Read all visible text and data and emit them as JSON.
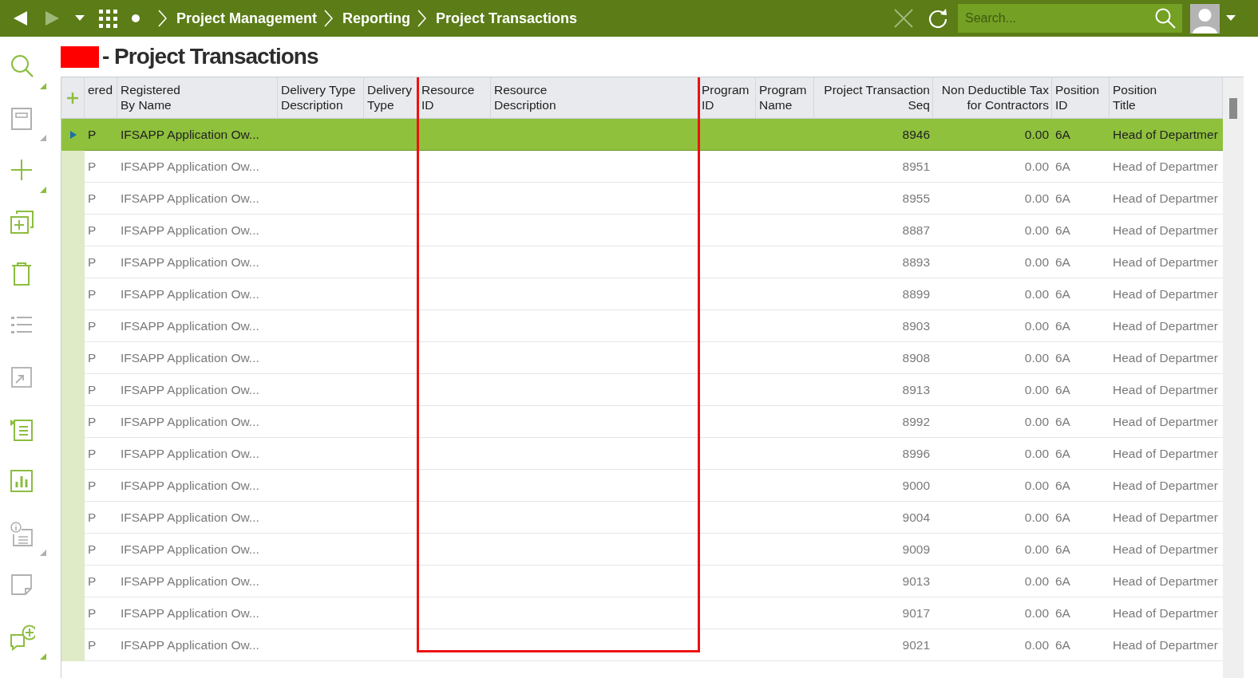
{
  "nav": {
    "breadcrumbs": [
      "Project Management",
      "Reporting",
      "Project Transactions"
    ],
    "search": {
      "placeholder": "Search..."
    }
  },
  "sidebar": {
    "tools": [
      {
        "kind": "search",
        "disabled": false,
        "has_menu": true
      },
      {
        "kind": "save",
        "disabled": true,
        "has_menu": true
      },
      {
        "kind": "add",
        "disabled": false,
        "has_menu": true
      },
      {
        "kind": "duplicate",
        "disabled": false,
        "has_menu": false
      },
      {
        "kind": "delete",
        "disabled": false,
        "has_menu": false
      },
      {
        "kind": "list",
        "disabled": true,
        "has_menu": false
      },
      {
        "kind": "export",
        "disabled": true,
        "has_menu": false
      },
      {
        "kind": "details",
        "disabled": false,
        "has_menu": false
      },
      {
        "kind": "chart",
        "disabled": false,
        "has_menu": false
      },
      {
        "kind": "info",
        "disabled": true,
        "has_menu": true
      },
      {
        "kind": "note",
        "disabled": true,
        "has_menu": false
      },
      {
        "kind": "comment",
        "disabled": false,
        "has_menu": true
      }
    ]
  },
  "page": {
    "redacted": true,
    "title": "- Project Transactions"
  },
  "table": {
    "columns": [
      {
        "label": "ered",
        "highlighted": false
      },
      {
        "label": "Registered By Name",
        "highlighted": false
      },
      {
        "label": "Delivery Type Description",
        "highlighted": false
      },
      {
        "label": "Delivery Type",
        "highlighted": false
      },
      {
        "label": "Resource ID",
        "highlighted": true
      },
      {
        "label": "Resource Description",
        "highlighted": true
      },
      {
        "label": "Program ID",
        "highlighted": false
      },
      {
        "label": "Program Name",
        "highlighted": false
      },
      {
        "label": "Project Transaction Seq",
        "highlighted": false
      },
      {
        "label": "Non Deductible Tax for Contractors",
        "highlighted": false
      },
      {
        "label": "Position ID",
        "highlighted": false
      },
      {
        "label": "Position Title",
        "highlighted": false
      }
    ],
    "rows": [
      {
        "selected": true,
        "cells": [
          "P",
          "IFSAPP Application Ow...",
          null,
          null,
          null,
          null,
          null,
          null,
          "8946",
          "0.00",
          "6A",
          "Head of Departmer"
        ]
      },
      {
        "selected": false,
        "cells": [
          "P",
          "IFSAPP Application Ow...",
          null,
          null,
          null,
          null,
          null,
          null,
          "8951",
          "0.00",
          "6A",
          "Head of Departmer"
        ]
      },
      {
        "selected": false,
        "cells": [
          "P",
          "IFSAPP Application Ow...",
          null,
          null,
          null,
          null,
          null,
          null,
          "8955",
          "0.00",
          "6A",
          "Head of Departmer"
        ]
      },
      {
        "selected": false,
        "cells": [
          "P",
          "IFSAPP Application Ow...",
          null,
          null,
          null,
          null,
          null,
          null,
          "8887",
          "0.00",
          "6A",
          "Head of Departmer"
        ]
      },
      {
        "selected": false,
        "cells": [
          "P",
          "IFSAPP Application Ow...",
          null,
          null,
          null,
          null,
          null,
          null,
          "8893",
          "0.00",
          "6A",
          "Head of Departmer"
        ]
      },
      {
        "selected": false,
        "cells": [
          "P",
          "IFSAPP Application Ow...",
          null,
          null,
          null,
          null,
          null,
          null,
          "8899",
          "0.00",
          "6A",
          "Head of Departmer"
        ]
      },
      {
        "selected": false,
        "cells": [
          "P",
          "IFSAPP Application Ow...",
          null,
          null,
          null,
          null,
          null,
          null,
          "8903",
          "0.00",
          "6A",
          "Head of Departmer"
        ]
      },
      {
        "selected": false,
        "cells": [
          "P",
          "IFSAPP Application Ow...",
          null,
          null,
          null,
          null,
          null,
          null,
          "8908",
          "0.00",
          "6A",
          "Head of Departmer"
        ]
      },
      {
        "selected": false,
        "cells": [
          "P",
          "IFSAPP Application Ow...",
          null,
          null,
          null,
          null,
          null,
          null,
          "8913",
          "0.00",
          "6A",
          "Head of Departmer"
        ]
      },
      {
        "selected": false,
        "cells": [
          "P",
          "IFSAPP Application Ow...",
          null,
          null,
          null,
          null,
          null,
          null,
          "8992",
          "0.00",
          "6A",
          "Head of Departmer"
        ]
      },
      {
        "selected": false,
        "cells": [
          "P",
          "IFSAPP Application Ow...",
          null,
          null,
          null,
          null,
          null,
          null,
          "8996",
          "0.00",
          "6A",
          "Head of Departmer"
        ]
      },
      {
        "selected": false,
        "cells": [
          "P",
          "IFSAPP Application Ow...",
          null,
          null,
          null,
          null,
          null,
          null,
          "9000",
          "0.00",
          "6A",
          "Head of Departmer"
        ]
      },
      {
        "selected": false,
        "cells": [
          "P",
          "IFSAPP Application Ow...",
          null,
          null,
          null,
          null,
          null,
          null,
          "9004",
          "0.00",
          "6A",
          "Head of Departmer"
        ]
      },
      {
        "selected": false,
        "cells": [
          "P",
          "IFSAPP Application Ow...",
          null,
          null,
          null,
          null,
          null,
          null,
          "9009",
          "0.00",
          "6A",
          "Head of Departmer"
        ]
      },
      {
        "selected": false,
        "cells": [
          "P",
          "IFSAPP Application Ow...",
          null,
          null,
          null,
          null,
          null,
          null,
          "9013",
          "0.00",
          "6A",
          "Head of Departmer"
        ]
      },
      {
        "selected": false,
        "cells": [
          "P",
          "IFSAPP Application Ow...",
          null,
          null,
          null,
          null,
          null,
          null,
          "9017",
          "0.00",
          "6A",
          "Head of Departmer"
        ]
      },
      {
        "selected": false,
        "cells": [
          "P",
          "IFSAPP Application Ow...",
          null,
          null,
          null,
          null,
          null,
          null,
          "9021",
          "0.00",
          "6A",
          "Head of Departmer"
        ]
      }
    ]
  },
  "annotation": {
    "kind": "frame",
    "color": "#ee1111"
  }
}
